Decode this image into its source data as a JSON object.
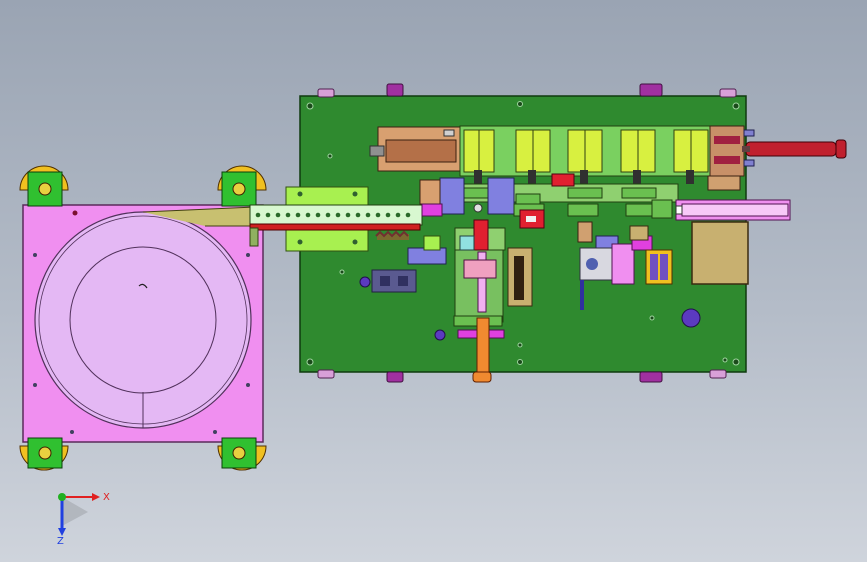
{
  "viewport": {
    "background_top": "#9aa4b3",
    "background_bottom": "#cfd4dc"
  },
  "triad": {
    "x_label": "X",
    "z_label": "Z",
    "x_color": "#e02020",
    "y_color": "#20b020",
    "z_color": "#2040e0"
  },
  "colors": {
    "bowl_base": "#f08ff0",
    "bowl_disk": "#e4b8f4",
    "main_plate": "#2f8a2f",
    "feeder_pad_yellow": "#f0c020",
    "lime": "#a8f050",
    "yellow_green": "#d8f040",
    "salmon": "#d8a070",
    "red_cylinder": "#c0202e",
    "magenta_clamp": "#e040e0",
    "purple_part": "#7050c0",
    "orange_rod": "#f08a30",
    "khaki_block": "#c8b070"
  },
  "icons": {
    "triad": "coordinate-triad-icon"
  }
}
